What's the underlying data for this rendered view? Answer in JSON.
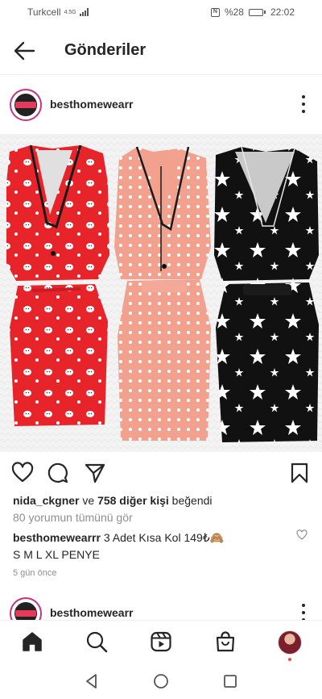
{
  "status_bar": {
    "carrier": "Turkcell",
    "network_type": "4.5G",
    "battery_percent": "%28",
    "battery_level": 0.28,
    "time": "22:02",
    "icons": [
      "signal-icon",
      "nfc-icon",
      "battery-icon"
    ]
  },
  "header": {
    "title": "Gönderiler",
    "back_icon": "arrow-left-icon"
  },
  "post": {
    "username": "besthomewearr",
    "avatar_label": "BESTHOMEWEAR",
    "image": {
      "description_items": [
        "red-pajama-set-cat-print",
        "pink-pajama-set-polka-dot",
        "black-pajama-set-star-print"
      ]
    },
    "likes": {
      "first_user": "nida_ckgner",
      "connector": "ve",
      "others": "758 diğer kişi",
      "suffix": "beğendi"
    },
    "view_comments": "80 yorumun tümünü gör",
    "caption": {
      "username": "besthomewearrr",
      "text_line1": "3 Adet Kısa Kol 149₺🙈",
      "text_line2": "S M L XL PENYE"
    },
    "timestamp": "5 gün önce"
  },
  "next_post": {
    "username": "besthomewearr"
  },
  "bottom_nav": {
    "items": [
      "home-icon",
      "search-icon",
      "reels-icon",
      "shop-icon",
      "profile-avatar"
    ]
  },
  "system_nav": {
    "items": [
      "back-triangle-icon",
      "home-circle-icon",
      "recents-square-icon"
    ]
  },
  "colors": {
    "text": "#262626",
    "secondary_text": "#8e8e8e",
    "story_ring": "#c13584",
    "notification": "#ed4956"
  }
}
